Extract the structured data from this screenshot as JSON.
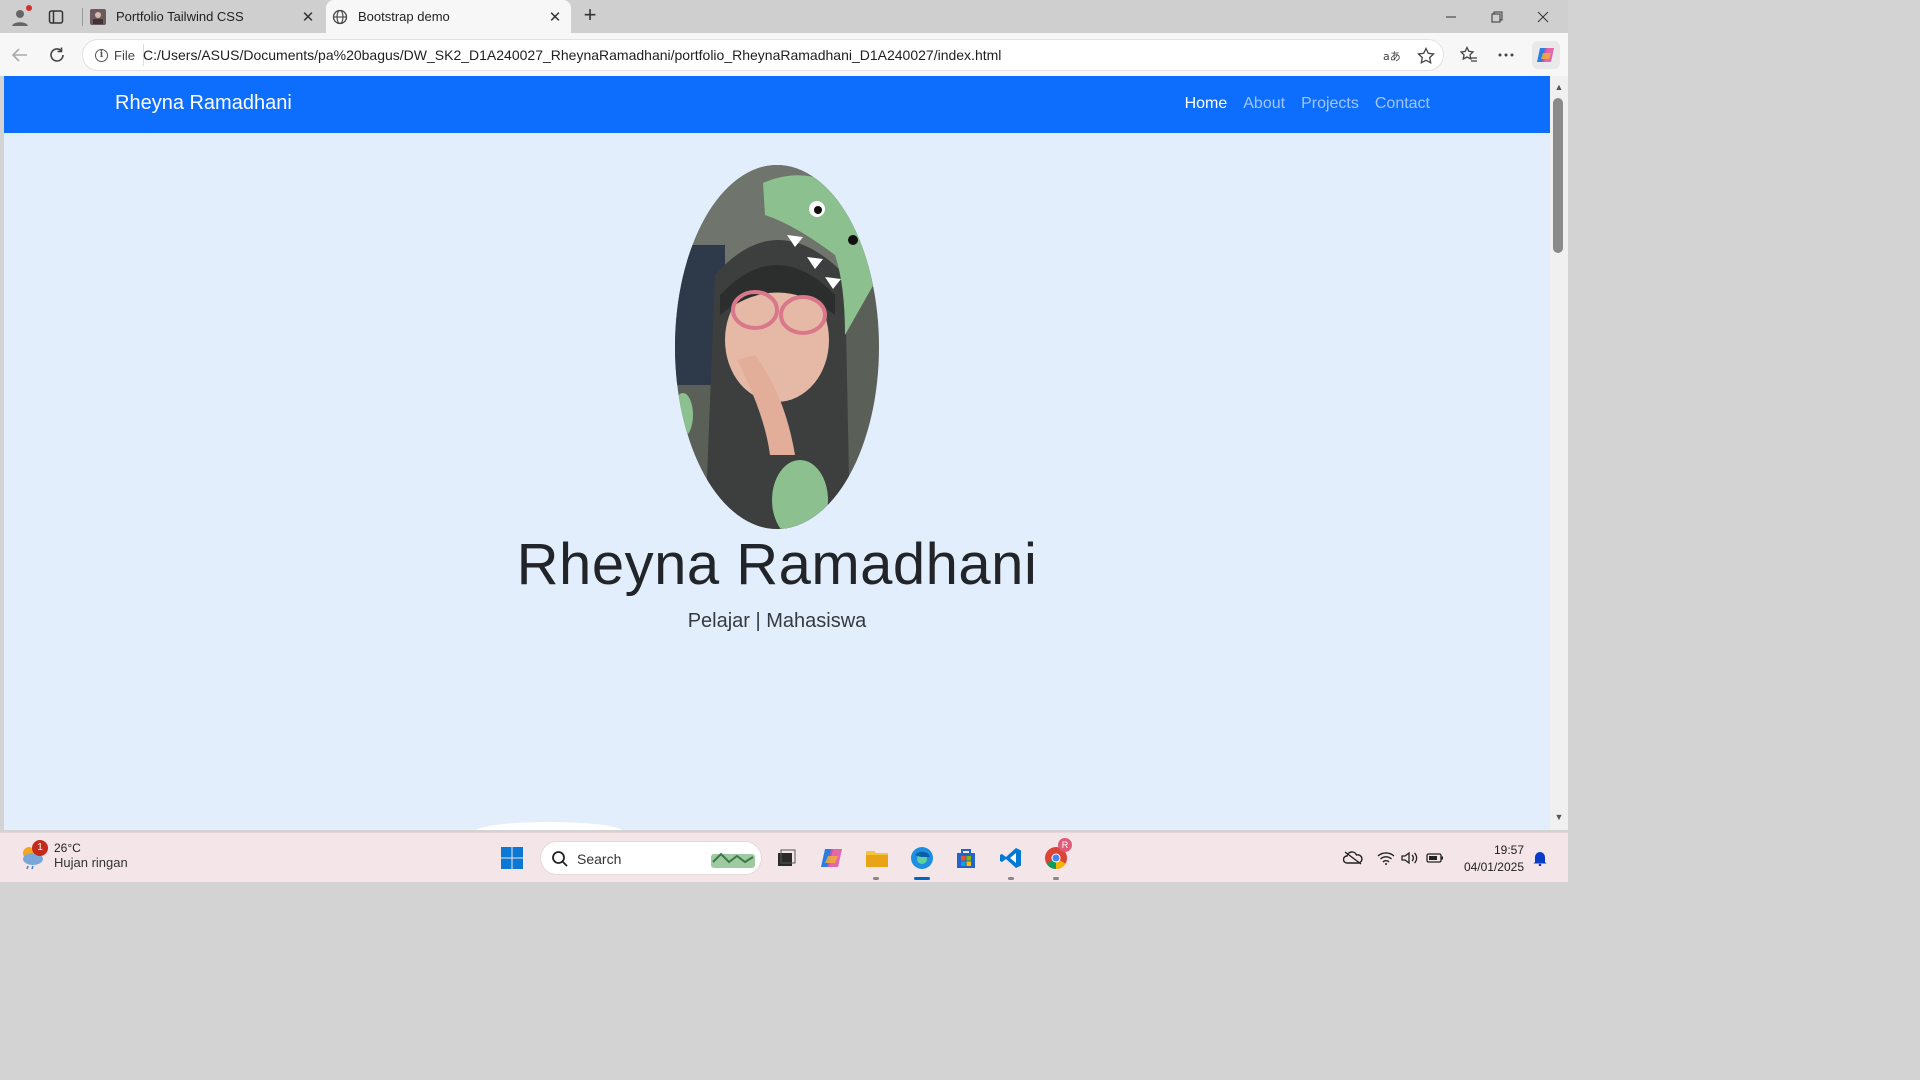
{
  "browser": {
    "tabs": [
      {
        "title": "Portfolio Tailwind CSS",
        "active": false
      },
      {
        "title": "Bootstrap demo",
        "active": true
      }
    ],
    "address_chip": "File",
    "url": "C:/Users/ASUS/Documents/pa%20bagus/DW_SK2_D1A240027_RheynaRamadhani/portfolio_RheynaRamadhani_D1A240027/index.html",
    "icons": [
      "profile-icon",
      "tab-actions-icon",
      "back-icon",
      "reload-icon",
      "info-icon",
      "read-aloud-icon",
      "favorite-star-icon",
      "favorites-icon",
      "more-icon",
      "copilot-icon"
    ]
  },
  "page": {
    "navbar": {
      "brand": "Rheyna Ramadhani",
      "links": [
        "Home",
        "About",
        "Projects",
        "Contact"
      ],
      "active_link": "Home"
    },
    "hero": {
      "name": "Rheyna Ramadhani",
      "subtitle": "Pelajar | Mahasiswa"
    },
    "colors": {
      "navbar": "#0d6efd",
      "page_background": "#e3eefd"
    }
  },
  "taskbar": {
    "weather": {
      "temp": "26°C",
      "desc": "Hujan ringan",
      "badge": "1"
    },
    "search_placeholder": "Search",
    "clock": {
      "time": "19:57",
      "date": "04/01/2025"
    },
    "apps": [
      "start-icon",
      "task-view-icon",
      "copilot-app-icon",
      "file-explorer-icon",
      "edge-icon",
      "store-icon",
      "vscode-icon",
      "chrome-icon"
    ],
    "chrome_badge": "R"
  }
}
